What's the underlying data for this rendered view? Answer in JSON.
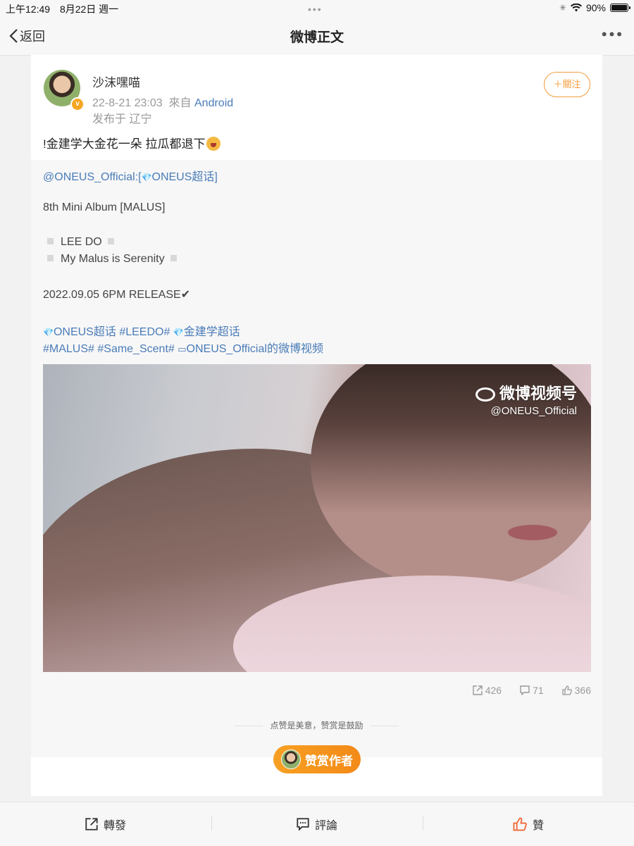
{
  "status_bar": {
    "time": "上午12:49",
    "date": "8月22日 週一",
    "battery": "90%",
    "battery_level": 0.9
  },
  "nav": {
    "back_label": "返回",
    "title": "微博正文"
  },
  "post": {
    "username": "沙沫嘿喵",
    "timestamp": "22-8-21 23:03",
    "source_prefix": "來自",
    "source": "Android",
    "location": "发布于 辽宁",
    "follow_label": "＋關注",
    "text": "!金建学大金花一朵 拉瓜都退下"
  },
  "repost": {
    "mention": "@ONEUS_Official",
    "colon_bracket": ":[",
    "topic1": "ONEUS超话",
    "close_bracket": "]",
    "album": "8th Mini Album [MALUS]",
    "track1": "LEE DO",
    "track2": "My Malus is Serenity",
    "release": "2022.09.05 6PM RELEASE",
    "check": "✔",
    "tags_line1": {
      "topic_a": "ONEUS超话",
      "tag_a": "#LEEDO#",
      "topic_b": "金建学超话"
    },
    "tags_line2": {
      "tag_b": "#MALUS#",
      "tag_c": "#Same_Scent#",
      "video_link": "ONEUS_Official的微博视频"
    },
    "watermark_title": "微博视频号",
    "watermark_handle": "@ONEUS_Official"
  },
  "stats": {
    "reposts": "426",
    "comments": "71",
    "likes": "366"
  },
  "reward": {
    "caption": "点赞是美意，赞赏是鼓励",
    "button_label": "赞赏作者"
  },
  "bottom_bar": {
    "repost_label": "轉發",
    "comment_label": "評論",
    "like_label": "贊"
  },
  "colors": {
    "link": "#4a7cb8",
    "accent": "#f29c3b",
    "like": "#f06a3a"
  }
}
